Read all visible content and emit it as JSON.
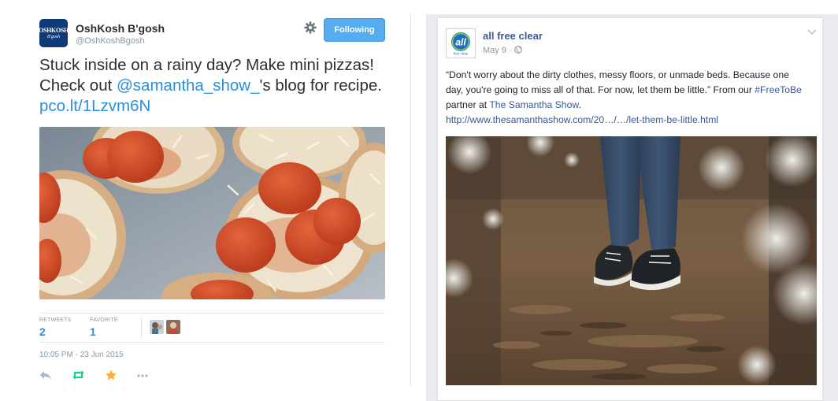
{
  "tweet": {
    "avatar": {
      "line1": "OSHKOSH",
      "line2": "B'gosh"
    },
    "author_name": "OshKosh B'gosh",
    "author_handle": "@OshKoshBgosh",
    "follow_button": "Following",
    "text": {
      "part1": "Stuck inside on a rainy day? Make mini pizzas! Check out ",
      "mention": "@samantha_show_",
      "part2": "'s  blog for recipe. ",
      "link": "pco.lt/1Lzvm6N"
    },
    "stats": {
      "retweets_label": "RETWEETS",
      "retweets": "2",
      "favorites_label": "FAVORITE",
      "favorites": "1"
    },
    "timestamp": "10:05 PM - 23 Jun 2015",
    "actions": [
      "reply-icon",
      "retweet-icon",
      "favorite-icon",
      "more-icon"
    ],
    "colors": {
      "link": "#2a8ed8",
      "follow_bg": "#55acee",
      "favorite_star": "#ffac33",
      "retweet_green": "#19cf86"
    }
  },
  "facebook": {
    "page_name": "all free clear",
    "logo_text": "all",
    "logo_subtext": "free clear",
    "date": "May 9 · ",
    "text": {
      "part1": "“Don't worry about the dirty clothes, messy floors, or unmade beds. Because one day, you're going to miss all of that. For now, let them be little.” From our ",
      "hashtag": "#FreeToBe",
      "part2": " partner at ",
      "partner": "The Samantha Show",
      "part3": ".",
      "url": "http://www.thesamanthashow.com/20…/…/let-them-be-little.html"
    },
    "colors": {
      "name": "#3b5998",
      "link": "#365899"
    }
  }
}
